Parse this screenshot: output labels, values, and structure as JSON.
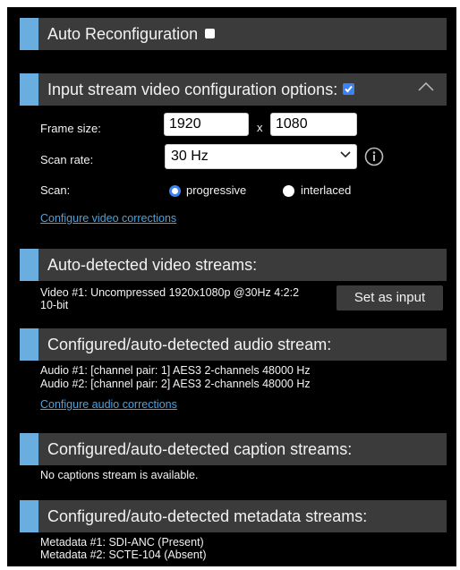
{
  "sections": {
    "auto_reconfig": {
      "title": "Auto Reconfiguration",
      "checked": false
    },
    "input_stream": {
      "title": "Input stream video configuration options:",
      "checked": true,
      "frame_size_label": "Frame size:",
      "width": "1920",
      "separator": "x",
      "height": "1080",
      "scan_rate_label": "Scan rate:",
      "scan_rate_value": "30 Hz",
      "scan_label": "Scan:",
      "scan_options": [
        "progressive",
        "interlaced"
      ],
      "scan_selected": "progressive",
      "video_corrections_link": "Configure video corrections"
    },
    "video_streams": {
      "title": "Auto-detected video streams:",
      "line1": "Video #1: Uncompressed 1920x1080p @30Hz 4:2:2",
      "line2": "10-bit",
      "set_input_label": "Set as input"
    },
    "audio_stream": {
      "title": "Configured/auto-detected audio stream:",
      "items": [
        "Audio #1: [channel pair: 1] AES3 2-channels 48000 Hz",
        "Audio #2: [channel pair: 2] AES3 2-channels 48000 Hz"
      ],
      "audio_corrections_link": "Configure audio corrections"
    },
    "caption_streams": {
      "title": "Configured/auto-detected caption streams:",
      "text": "No captions stream is available."
    },
    "metadata_streams": {
      "title": "Configured/auto-detected metadata streams:",
      "items": [
        "Metadata #1: SDI-ANC (Present)",
        "Metadata #2: SCTE-104 (Absent)"
      ]
    }
  },
  "colors": {
    "background": "#000000",
    "header": "#3b3b3b",
    "accent": "#6aaedf",
    "link": "#4aa3df",
    "checkbox_checked": "#3b82f6"
  },
  "icons": {
    "chevron_up": "chevron-up-icon",
    "info": "info-icon",
    "dropdown": "chevron-down-icon"
  }
}
